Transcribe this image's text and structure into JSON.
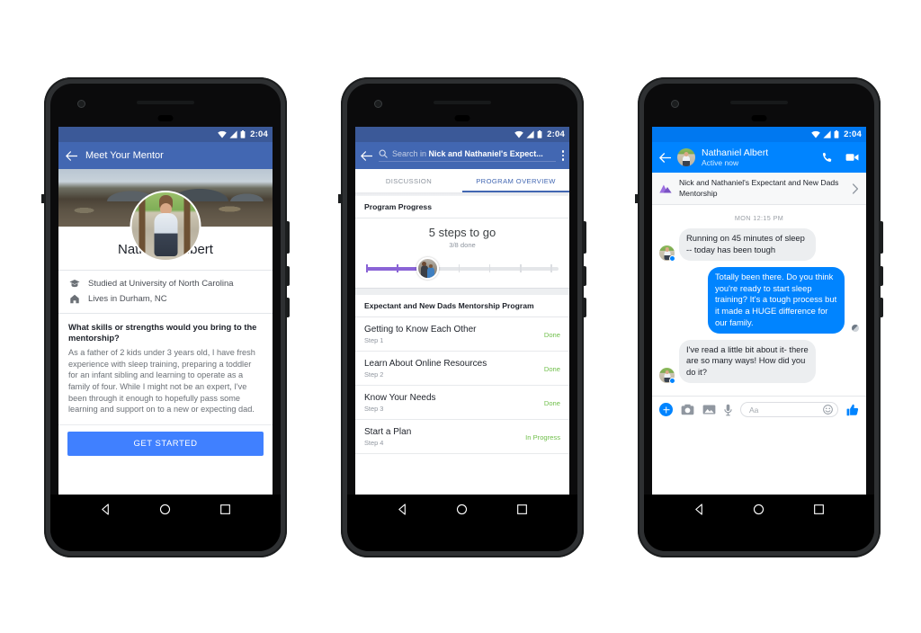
{
  "phones": [
    {
      "id": "mentor-profile",
      "status_bar": {
        "time": "2:04",
        "icons": [
          "wifi-icon",
          "signal-icon",
          "battery-icon"
        ]
      },
      "appbar": {
        "back_icon": "back-arrow-icon",
        "title": "Meet Your Mentor"
      },
      "profile": {
        "name": "Nathaniel Albert",
        "cover_photo": "mountain-landscape-cover-photo",
        "avatar": "profile-photo-father-and-child",
        "info": [
          {
            "icon": "graduation-cap-icon",
            "text": "Studied at University of North Carolina"
          },
          {
            "icon": "home-icon",
            "text": "Lives in Durham, NC"
          }
        ],
        "question": "What skills or strengths would you bring to the mentorship?",
        "answer": "As a father of 2 kids under 3 years old, I have fresh experience with sleep training, preparing a toddler for an infant sibling and learning to operate as a family of four. While I might not be an expert, I've been through it enough to hopefully pass some learning and support on to a new or expecting dad."
      },
      "cta_label": "GET STARTED"
    },
    {
      "id": "program-overview",
      "status_bar": {
        "time": "2:04"
      },
      "appbar": {
        "back_icon": "back-arrow-icon",
        "search_icon": "search-icon",
        "search_prefix": "Search in ",
        "search_group": "Nick and Nathaniel's Expect...",
        "overflow_icon": "kebab-menu-icon"
      },
      "tabs": [
        {
          "label": "DISCUSSION",
          "active": false
        },
        {
          "label": "PROGRAM OVERVIEW",
          "active": true
        }
      ],
      "progress_section_title": "Program Progress",
      "progress": {
        "headline": "5 steps to go",
        "subline": "3/8 done",
        "done": 3,
        "total": 8,
        "fill_color": "#8a64d6",
        "thumb": "group-avatar-thumb"
      },
      "program_title": "Expectant and New Dads Mentorship Program",
      "steps": [
        {
          "title": "Getting to Know Each Other",
          "step": "Step 1",
          "status": "Done"
        },
        {
          "title": "Learn About Online Resources",
          "step": "Step 2",
          "status": "Done"
        },
        {
          "title": "Know Your Needs",
          "step": "Step 3",
          "status": "Done"
        },
        {
          "title": "Start a Plan",
          "step": "Step 4",
          "status": "In Progress"
        }
      ],
      "status_color": "#6fbf4a"
    },
    {
      "id": "messenger-thread",
      "status_bar": {
        "time": "2:04"
      },
      "header": {
        "back_icon": "back-arrow-icon",
        "avatar": "contact-avatar",
        "name": "Nathaniel Albert",
        "status": "Active now",
        "call_icon": "phone-call-icon",
        "video_icon": "video-call-icon",
        "accent": "#0084ff"
      },
      "context_row": {
        "icon": "mountain-group-icon",
        "text": "Nick and Nathaniel's Expectant and New Dads Mentorship",
        "chevron": "chevron-right-icon"
      },
      "daystamp": "MON 12:15 PM",
      "messages": [
        {
          "from": "them",
          "text": "Running on 45 minutes of sleep -- today has been tough"
        },
        {
          "from": "me",
          "text": "Totally been there. Do you think you're ready to start sleep training? It's a tough process but it made a HUGE difference for our family."
        },
        {
          "from": "them",
          "text": "I've read a little bit about it- there are so many ways! How did you do it?"
        }
      ],
      "composer": {
        "plus_icon": "plus-icon",
        "camera_icon": "camera-icon",
        "gallery_icon": "gallery-icon",
        "mic_icon": "microphone-icon",
        "input_placeholder": "Aa",
        "emoji_icon": "emoji-icon",
        "like_icon": "thumbs-up-icon"
      }
    }
  ],
  "android_nav": {
    "back": "nav-back-icon",
    "home": "nav-home-icon",
    "recents": "nav-recents-icon"
  }
}
